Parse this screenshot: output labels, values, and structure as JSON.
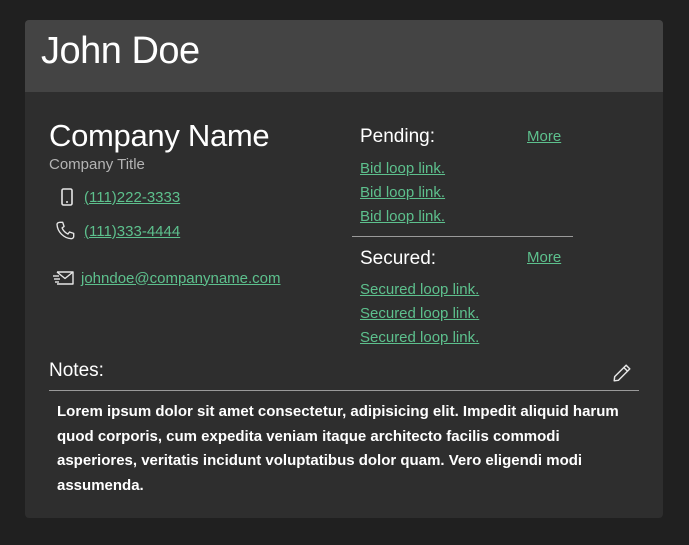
{
  "contact": {
    "name": "John Doe",
    "company_name": "Company Name",
    "company_title": "Company Title",
    "phone_mobile": "(111)222-3333",
    "phone_office": "(111)333-4444",
    "email": "johndoe@companyname.com"
  },
  "pending": {
    "title": "Pending:",
    "more_label": "More",
    "links": [
      "Bid loop link.",
      "Bid loop link.",
      "Bid loop link."
    ]
  },
  "secured": {
    "title": "Secured:",
    "more_label": "More",
    "links": [
      "Secured loop link.",
      "Secured loop link.",
      "Secured loop link."
    ]
  },
  "notes": {
    "title": "Notes:",
    "body": "Lorem ipsum dolor sit amet consectetur, adipisicing elit. Impedit aliquid harum quod corporis, cum expedita veniam itaque architecto facilis commodi asperiores, veritatis incidunt voluptatibus dolor quam. Vero eligendi modi assumenda."
  },
  "icons": {
    "mobile": "mobile-phone-icon",
    "phone": "phone-handset-icon",
    "email": "envelope-icon",
    "edit": "pencil-icon"
  },
  "colors": {
    "page_bg": "#202020",
    "card_bg": "#2e2e2e",
    "header_bg": "#444444",
    "link": "#5dc08d"
  }
}
